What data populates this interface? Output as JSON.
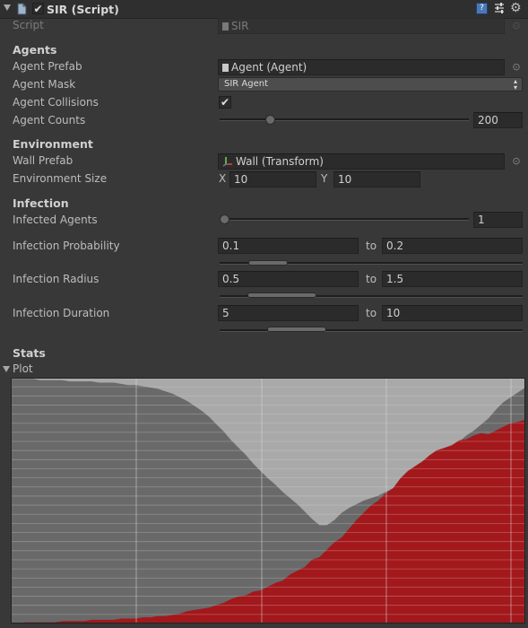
{
  "header": {
    "title": "SIR (Script)",
    "enabled": true
  },
  "script_row": {
    "label": "Script",
    "value": "SIR"
  },
  "sections": {
    "agents": "Agents",
    "environment": "Environment",
    "infection": "Infection",
    "stats": "Stats"
  },
  "agents": {
    "prefab_label": "Agent Prefab",
    "prefab_value": "Agent (Agent)",
    "mask_label": "Agent Mask",
    "mask_value": "SIR Agent",
    "collisions_label": "Agent Collisions",
    "collisions_checked": true,
    "counts_label": "Agent Counts",
    "counts_value": "200",
    "counts_slider_fraction": 0.12
  },
  "environment": {
    "wall_label": "Wall Prefab",
    "wall_value": "Wall (Transform)",
    "size_label": "Environment Size",
    "x_label": "X",
    "x_value": "10",
    "y_label": "Y",
    "y_value": "10"
  },
  "infection": {
    "infected_label": "Infected Agents",
    "infected_value": "1",
    "infected_slider_fraction": 0.0,
    "probability": {
      "label": "Infection Probability",
      "min": "0.1",
      "to": "to",
      "max": "0.2",
      "range": [
        0.1,
        0.2
      ]
    },
    "radius": {
      "label": "Infection Radius",
      "min": "0.5",
      "to": "to",
      "max": "1.5",
      "range": [
        0.5,
        1.5
      ]
    },
    "duration": {
      "label": "Infection Duration",
      "min": "5",
      "to": "to",
      "max": "10",
      "range": [
        5,
        10
      ]
    }
  },
  "stats": {
    "plot_label": "Plot"
  },
  "colors": {
    "susceptible": "#a9a9a9",
    "infected": "#a3181b",
    "recovered": "#696969",
    "grid": "#d8d8d8"
  },
  "chart_data": {
    "type": "area",
    "title": "",
    "ylim": [
      0,
      200
    ],
    "x": [
      0,
      10,
      20,
      30,
      40,
      50,
      60,
      70,
      80,
      90,
      100,
      110,
      120,
      130,
      140,
      150,
      160,
      170,
      180,
      190,
      200,
      210,
      220,
      230,
      240,
      250,
      260,
      270,
      280,
      290,
      300,
      310,
      320,
      330,
      340,
      350,
      360,
      370,
      380,
      390,
      400,
      410,
      420,
      430,
      440,
      450,
      460,
      470,
      480,
      490,
      500,
      510,
      520,
      530,
      540,
      550,
      560,
      570,
      580,
      590,
      600,
      610,
      620,
      630,
      640,
      650,
      660,
      670,
      680,
      690,
      700
    ],
    "series": [
      {
        "values": [
          0,
          0,
          1,
          1,
          1,
          1,
          1,
          2,
          2,
          2,
          2,
          3,
          3,
          3,
          3,
          4,
          4,
          4,
          5,
          5,
          6,
          6,
          7,
          8,
          10,
          11,
          12,
          13,
          15,
          17,
          20,
          22,
          23,
          26,
          27,
          30,
          33,
          35,
          40,
          43,
          46,
          52,
          54,
          60,
          66,
          70,
          77,
          84,
          90,
          96,
          100,
          106,
          110,
          118,
          124,
          128,
          132,
          137,
          141,
          143,
          145,
          149,
          150,
          153,
          155,
          154,
          157,
          160,
          163,
          164,
          166
        ]
      },
      {
        "values": [
          1,
          1,
          1,
          1,
          2,
          2,
          2,
          2,
          3,
          3,
          3,
          3,
          4,
          4,
          4,
          5,
          6,
          6,
          7,
          8,
          9,
          11,
          13,
          16,
          19,
          23,
          27,
          32,
          38,
          44,
          51,
          57,
          63,
          70,
          76,
          82,
          87,
          93,
          98,
          103,
          109,
          115,
          120,
          120,
          116,
          110,
          106,
          103,
          100,
          98,
          96,
          93,
          90,
          86,
          82,
          78,
          74,
          68,
          63,
          59,
          56,
          52,
          47,
          43,
          38,
          33,
          26,
          20,
          16,
          12,
          8
        ]
      }
    ]
  }
}
